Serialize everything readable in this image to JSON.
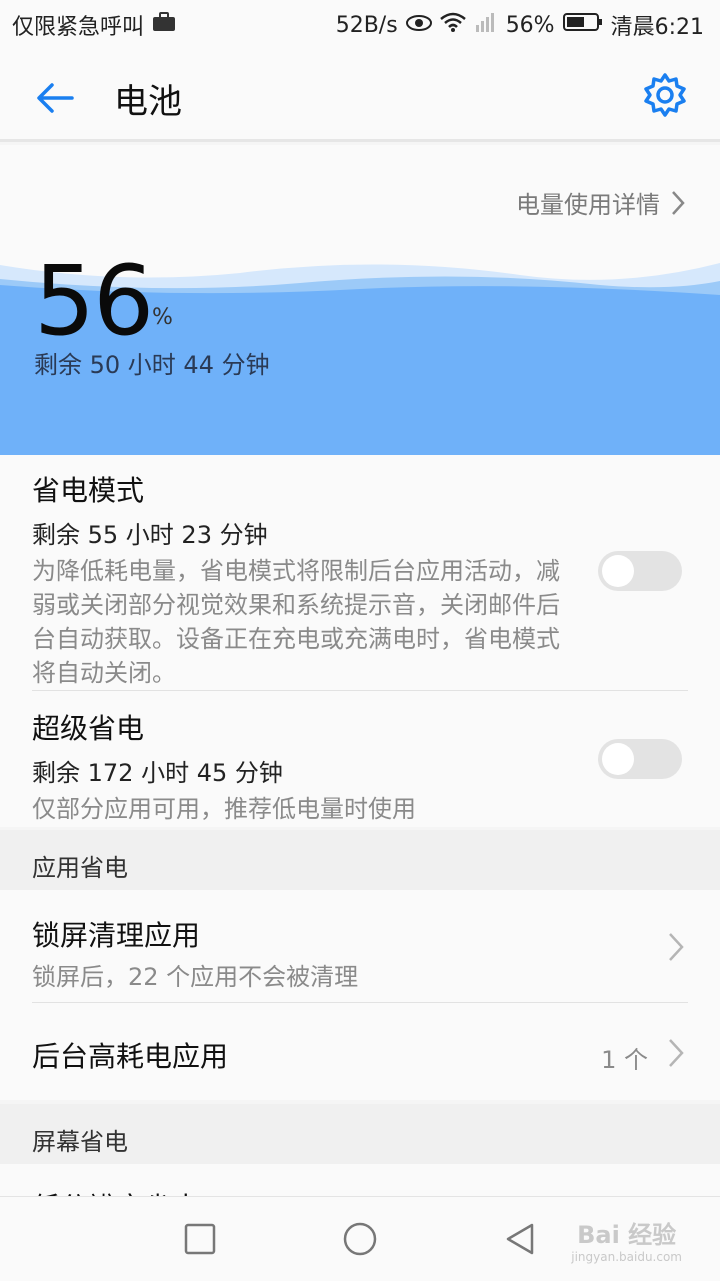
{
  "status_bar": {
    "left_text": "仅限紧急呼叫",
    "speed": "52B/s",
    "battery_pct": "56%",
    "time": "清晨6:21"
  },
  "app_bar": {
    "title": "电池"
  },
  "hero": {
    "usage_details_label": "电量使用详情",
    "battery_level": "56",
    "battery_unit": "%",
    "remaining": "剩余 50 小时 44 分钟",
    "wave_color": "#6fb1f9"
  },
  "power_saving": {
    "title": "省电模式",
    "remaining": "剩余 55 小时 23 分钟",
    "description": "为降低耗电量，省电模式将限制后台应用活动，减弱或关闭部分视觉效果和系统提示音，关闭邮件后台自动获取。设备正在充电或充满电时，省电模式将自动关闭。",
    "enabled": false
  },
  "ultra_saving": {
    "title": "超级省电",
    "remaining": "剩余 172 小时 45 分钟",
    "description": "仅部分应用可用，推荐低电量时使用",
    "enabled": false
  },
  "app_saving_section": {
    "header": "应用省电",
    "lock_screen_cleanup": {
      "title": "锁屏清理应用",
      "subtitle": "锁屏后，22 个应用不会被清理"
    },
    "background_high_power": {
      "title": "后台高耗电应用",
      "count": "1 个"
    }
  },
  "screen_saving_section": {
    "header": "屏幕省电",
    "partial_item": "低分辨率省电"
  },
  "watermark": {
    "line1": "Bai 经验",
    "line2": "jingyan.baidu.com"
  },
  "colors": {
    "accent": "#1a7ff0",
    "wave": "#6fb1f9",
    "wave_light": "#d6e8fc"
  }
}
